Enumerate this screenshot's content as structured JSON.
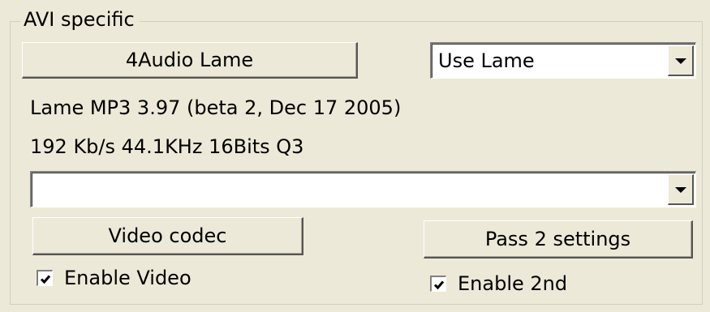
{
  "group": {
    "title": "AVI specific"
  },
  "audio": {
    "button_label": "4Audio Lame",
    "encoder_select_value": "Use Lame",
    "version_text": "Lame MP3 3.97 (beta 2, Dec 17 2005)",
    "settings_text": "192 Kb/s 44.1KHz 16Bits Q3"
  },
  "video": {
    "codec_select_value": "",
    "codec_button_label": "Video codec",
    "pass2_button_label": "Pass 2 settings"
  },
  "checkboxes": {
    "enable_video": {
      "label": "Enable Video",
      "checked": true
    },
    "enable_2nd": {
      "label": "Enable 2nd",
      "checked": true
    }
  },
  "icons": {
    "dropdown": "chevron-down-icon",
    "check": "checkmark-icon"
  }
}
